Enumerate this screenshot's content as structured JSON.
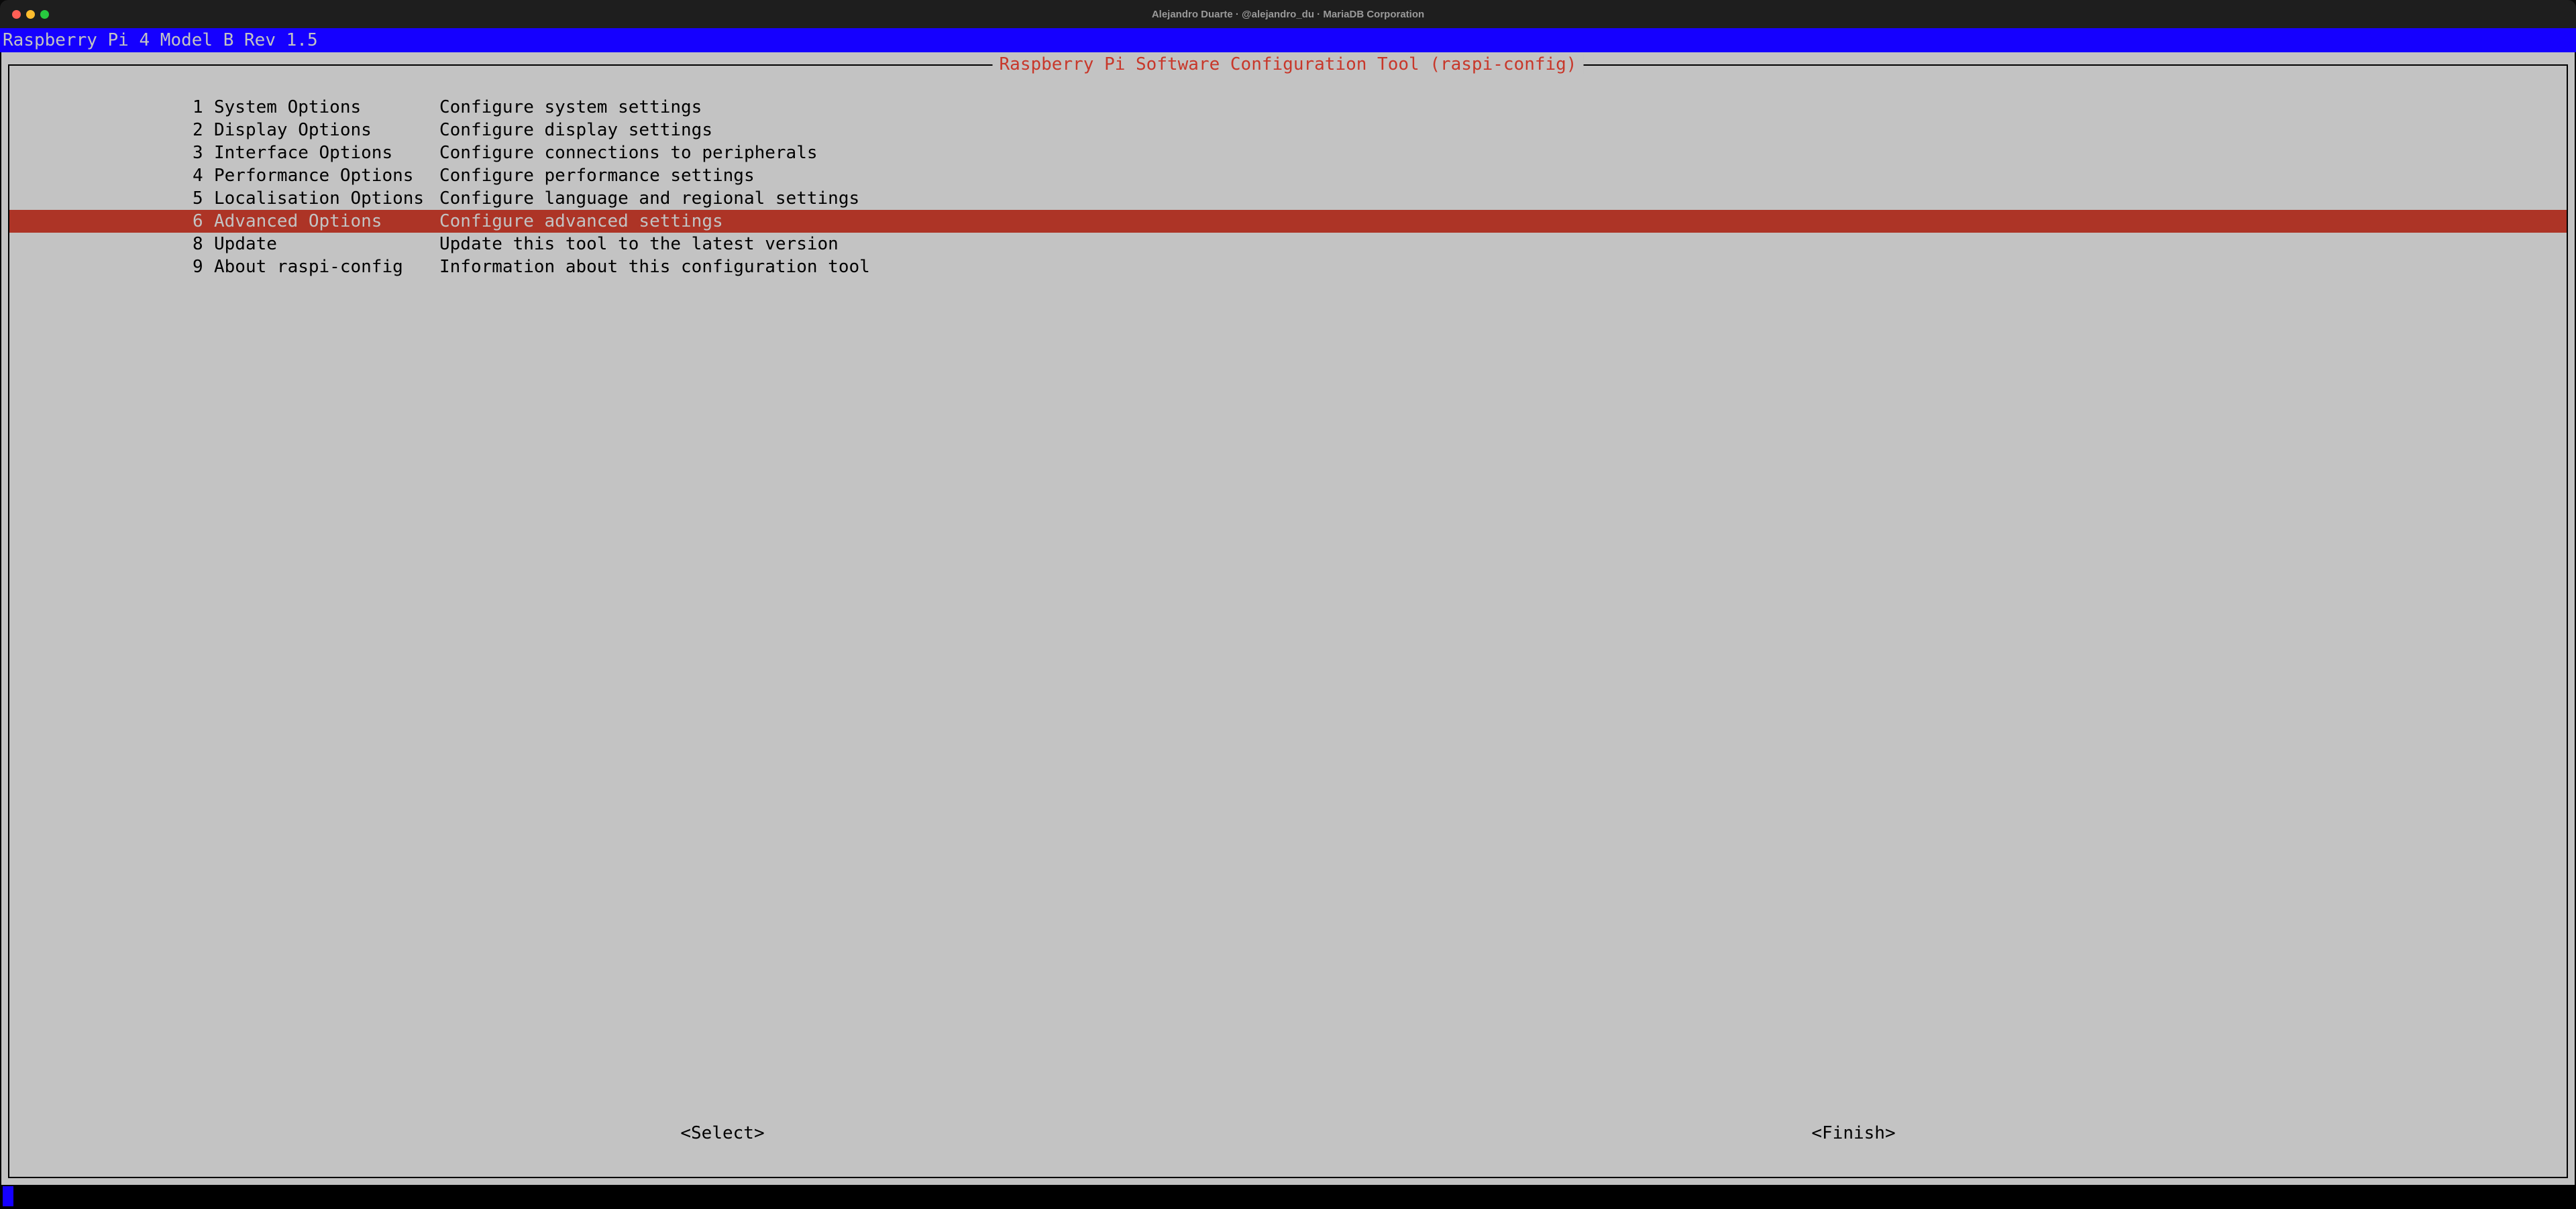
{
  "window": {
    "title": "Alejandro Duarte · @alejandro_du · MariaDB Corporation"
  },
  "header": {
    "model": "Raspberry Pi 4 Model B Rev 1.5"
  },
  "dialog": {
    "title": "Raspberry Pi Software Configuration Tool (raspi-config)",
    "selected_index": 5,
    "items": [
      {
        "num": "1",
        "label": "System Options",
        "desc": "Configure system settings"
      },
      {
        "num": "2",
        "label": "Display Options",
        "desc": "Configure display settings"
      },
      {
        "num": "3",
        "label": "Interface Options",
        "desc": "Configure connections to peripherals"
      },
      {
        "num": "4",
        "label": "Performance Options",
        "desc": "Configure performance settings"
      },
      {
        "num": "5",
        "label": "Localisation Options",
        "desc": "Configure language and regional settings"
      },
      {
        "num": "6",
        "label": "Advanced Options",
        "desc": "Configure advanced settings"
      },
      {
        "num": "8",
        "label": "Update",
        "desc": "Update this tool to the latest version"
      },
      {
        "num": "9",
        "label": "About raspi-config",
        "desc": "Information about this configuration tool"
      }
    ],
    "buttons": {
      "select": "<Select>",
      "finish": "<Finish>"
    }
  }
}
